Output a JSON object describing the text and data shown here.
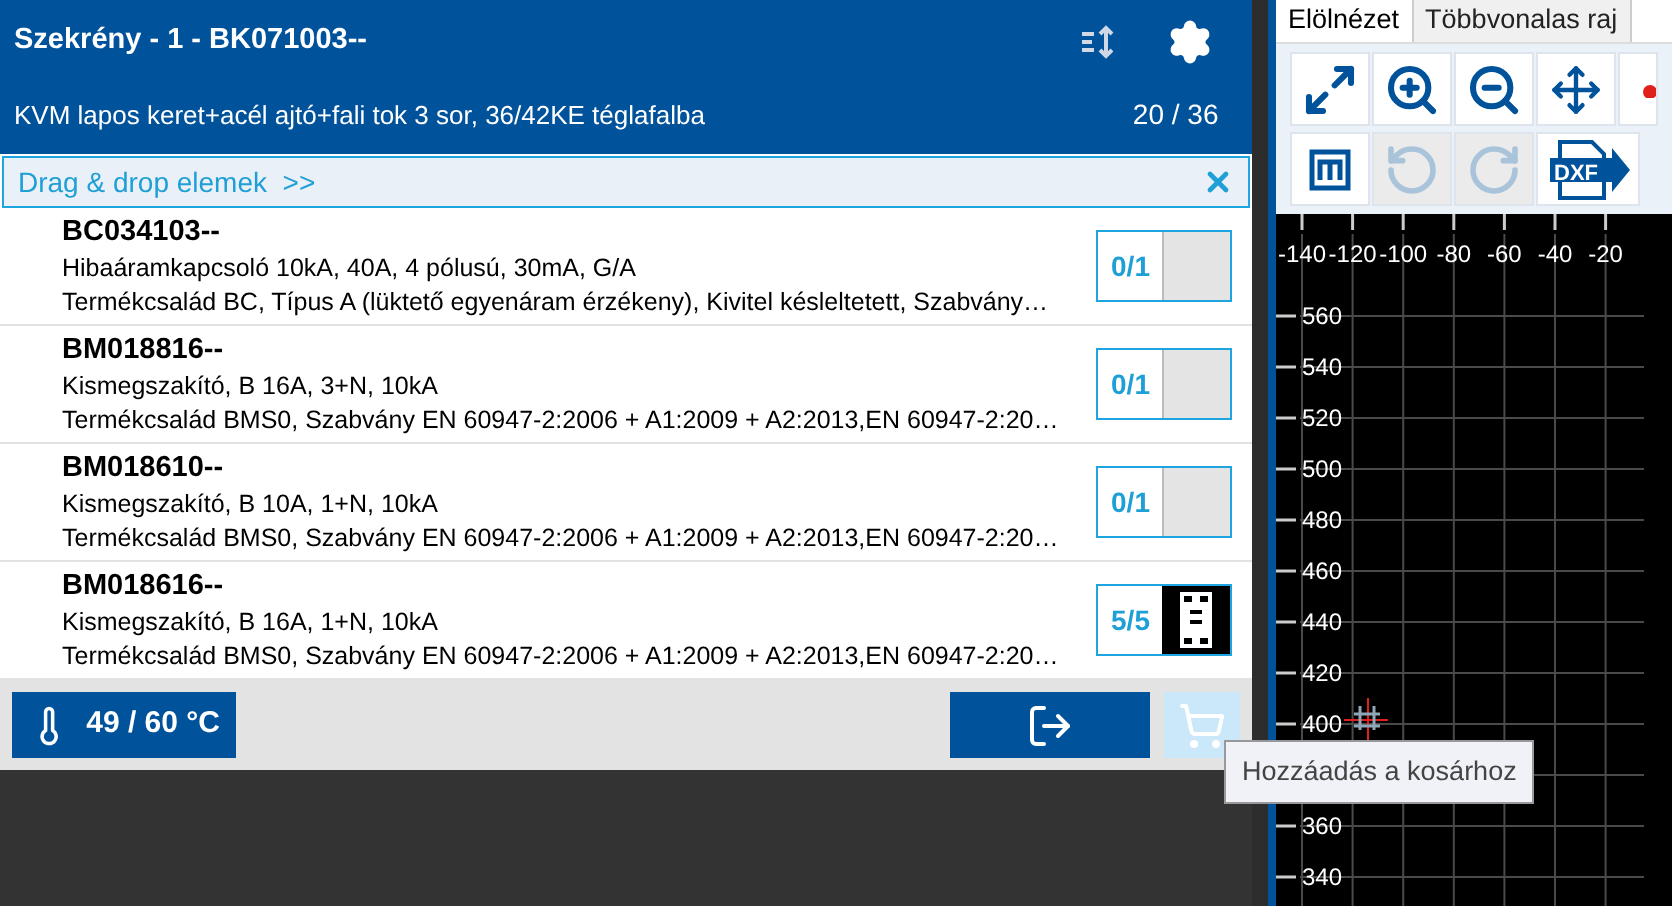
{
  "header": {
    "title": "Szekrény - 1 - BK071003--",
    "subtitle": "KVM lapos keret+acél ajtó+fali tok 3 sor, 36/42KE téglafalba",
    "counter": "20 / 36"
  },
  "drag_bar": {
    "label": "Drag & drop elemek  >>"
  },
  "items": [
    {
      "code": "BC034103--",
      "name": "Hibaáramkapcsoló 10kA, 40A, 4 pólusú, 30mA, G/A",
      "details": "Termékcsalád BC, Típus A (lüktető egyenáram érzékeny), Kivitel késleltetett, Szabvány…",
      "count": "0/1",
      "placed": false
    },
    {
      "code": "BM018816--",
      "name": "Kismegszakító, B 16A, 3+N, 10kA",
      "details": "Termékcsalád BMS0, Szabvány EN 60947-2:2006 + A1:2009 + A2:2013,EN 60947-2:20…",
      "count": "0/1",
      "placed": false
    },
    {
      "code": "BM018610--",
      "name": "Kismegszakító, B 10A, 1+N, 10kA",
      "details": "Termékcsalád BMS0, Szabvány EN 60947-2:2006 + A1:2009 + A2:2013,EN 60947-2:20…",
      "count": "0/1",
      "placed": false
    },
    {
      "code": "BM018616--",
      "name": "Kismegszakító, B 16A, 1+N, 10kA",
      "details": "Termékcsalád BMS0, Szabvány EN 60947-2:2006 + A1:2009 + A2:2013,EN 60947-2:20…",
      "count": "5/5",
      "placed": true
    }
  ],
  "footer": {
    "temperature": "49 / 60 °C",
    "cart_disabled": true
  },
  "tooltip": "Hozzáadás a kosárhoz",
  "right_tabs": [
    {
      "label": "Elölnézet",
      "selected": true
    },
    {
      "label": "Többvonalas raj",
      "selected": false
    }
  ],
  "toolbar_rows": [
    [
      {
        "kind": "fit",
        "disabled": false
      },
      {
        "kind": "zoom-in",
        "disabled": false
      },
      {
        "kind": "zoom-out",
        "disabled": false
      },
      {
        "kind": "move",
        "disabled": false
      },
      {
        "kind": "marker",
        "disabled": false
      }
    ],
    [
      {
        "kind": "module",
        "disabled": false
      },
      {
        "kind": "undo",
        "disabled": true
      },
      {
        "kind": "redo",
        "disabled": true
      },
      {
        "kind": "dxf",
        "disabled": false,
        "label": "DXF"
      }
    ]
  ],
  "canvas": {
    "x_labels": [
      "-140",
      "-120",
      "-100",
      "-80",
      "-60",
      "-40",
      "-20"
    ],
    "y_labels_upper": [
      "560",
      "540",
      "520",
      "500",
      "480",
      "460",
      "440",
      "420",
      "400"
    ],
    "y_labels_lower": [
      "360",
      "340"
    ]
  }
}
